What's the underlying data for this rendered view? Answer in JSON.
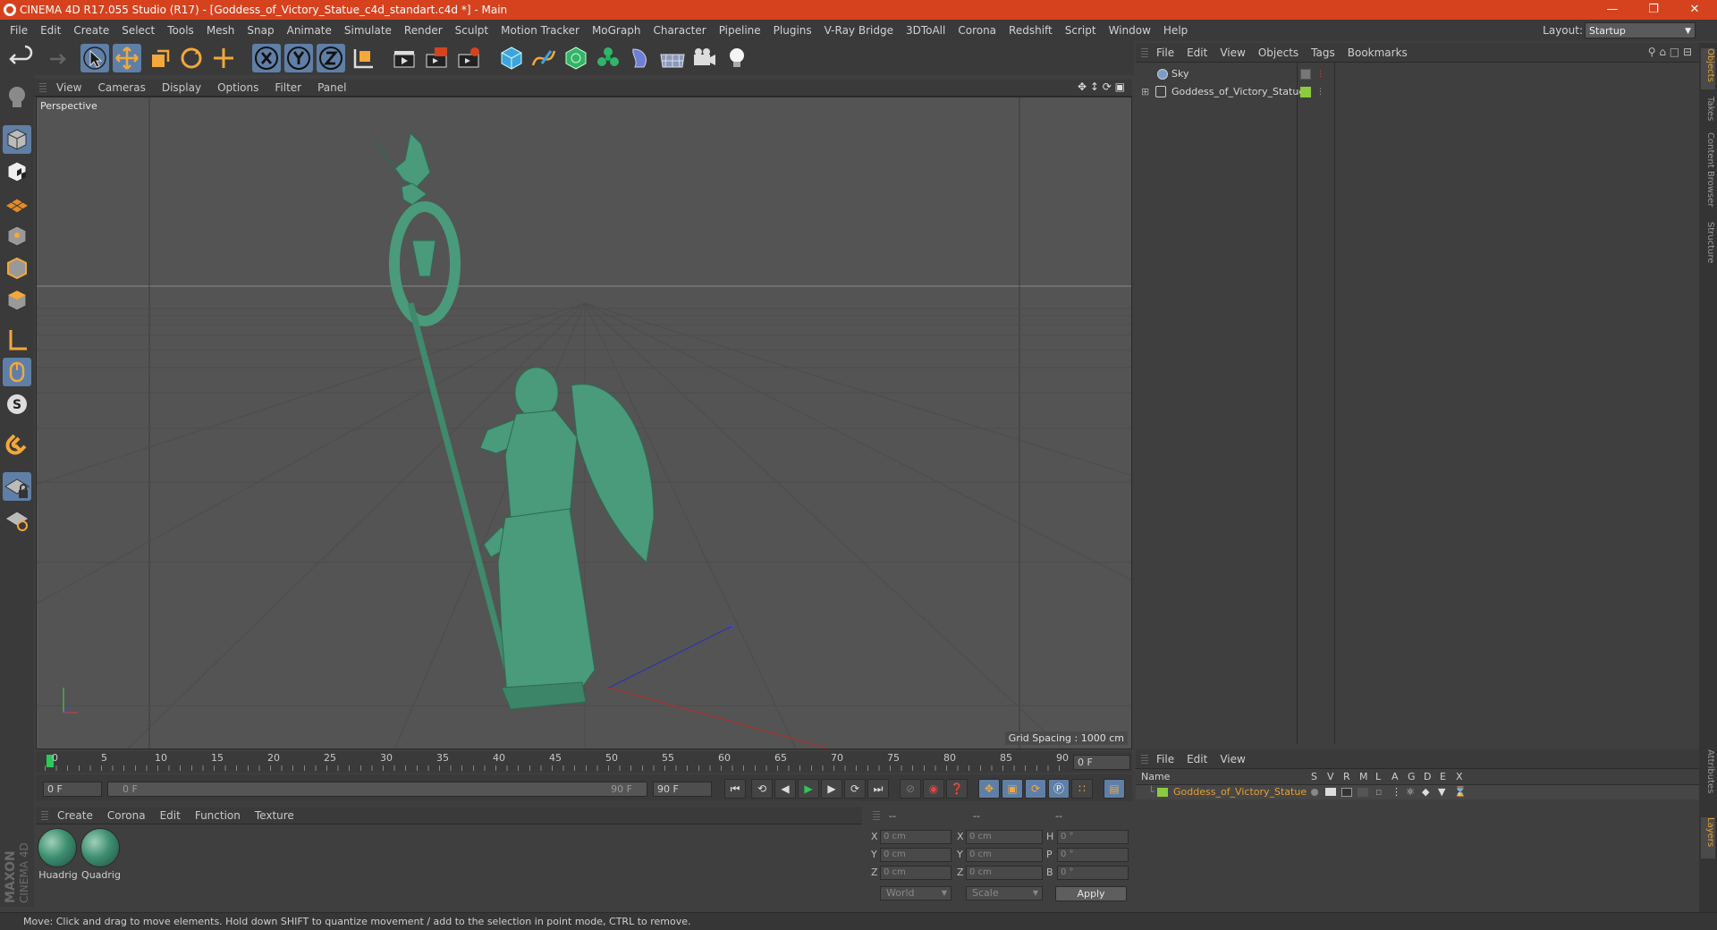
{
  "window": {
    "title": "CINEMA 4D R17.055 Studio (R17) - [Goddess_of_Victory_Statue_c4d_standart.c4d *] - Main"
  },
  "menubar": {
    "items": [
      "File",
      "Edit",
      "Create",
      "Select",
      "Tools",
      "Mesh",
      "Snap",
      "Animate",
      "Simulate",
      "Render",
      "Sculpt",
      "Motion Tracker",
      "MoGraph",
      "Character",
      "Pipeline",
      "Plugins",
      "V-Ray Bridge",
      "3DToAll",
      "Corona",
      "Redshift",
      "Script",
      "Window",
      "Help"
    ],
    "layout_label": "Layout:",
    "layout_value": "Startup"
  },
  "viewport": {
    "menu": [
      "View",
      "Cameras",
      "Display",
      "Options",
      "Filter",
      "Panel"
    ],
    "label": "Perspective",
    "grid_spacing": "Grid Spacing : 1000 cm"
  },
  "timeline": {
    "ticks": [
      "0",
      "5",
      "10",
      "15",
      "20",
      "25",
      "30",
      "35",
      "40",
      "45",
      "50",
      "55",
      "60",
      "65",
      "70",
      "75",
      "80",
      "85",
      "90"
    ],
    "current": "0 F",
    "start": "0 F",
    "range_start": "0 F",
    "range_end": "90 F",
    "end": "90 F"
  },
  "materials": {
    "menu": [
      "Create",
      "Corona",
      "Edit",
      "Function",
      "Texture"
    ],
    "items": [
      "Huadrig",
      "Quadrig"
    ]
  },
  "coords": {
    "headers": [
      "--",
      "--",
      "--"
    ],
    "row_labels_a": [
      "X",
      "Y",
      "Z"
    ],
    "row_labels_b": [
      "X",
      "Y",
      "Z"
    ],
    "row_labels_c": [
      "H",
      "P",
      "B"
    ],
    "values_a": [
      "0 cm",
      "0 cm",
      "0 cm"
    ],
    "values_b": [
      "0 cm",
      "0 cm",
      "0 cm"
    ],
    "values_c": [
      "0 °",
      "0 °",
      "0 °"
    ],
    "mode_world": "World",
    "mode_scale": "Scale",
    "apply": "Apply"
  },
  "object_manager": {
    "menu": [
      "File",
      "Edit",
      "View",
      "Objects",
      "Tags",
      "Bookmarks"
    ],
    "objects": [
      "Sky",
      "Goddess_of_Victory_Statue"
    ]
  },
  "layer_manager": {
    "menu": [
      "File",
      "Edit",
      "View"
    ],
    "columns": [
      "Name",
      "S",
      "V",
      "R",
      "M",
      "L",
      "A",
      "G",
      "D",
      "E",
      "X"
    ],
    "layer_name": "Goddess_of_Victory_Statue"
  },
  "side_tabs": [
    "Objects",
    "Takes",
    "Content Browser",
    "Structure",
    "Attributes",
    "Layers"
  ],
  "brand": [
    "MAXON",
    "CINEMA 4D"
  ],
  "status": "Move: Click and drag to move elements. Hold down SHIFT to quantize movement / add to the selection in point mode, CTRL to remove.",
  "colors": {
    "accent": "#d6421e",
    "selected": "#5f7fa7",
    "layer_green": "#8ccc3c",
    "statue": "#4a9a7c"
  }
}
